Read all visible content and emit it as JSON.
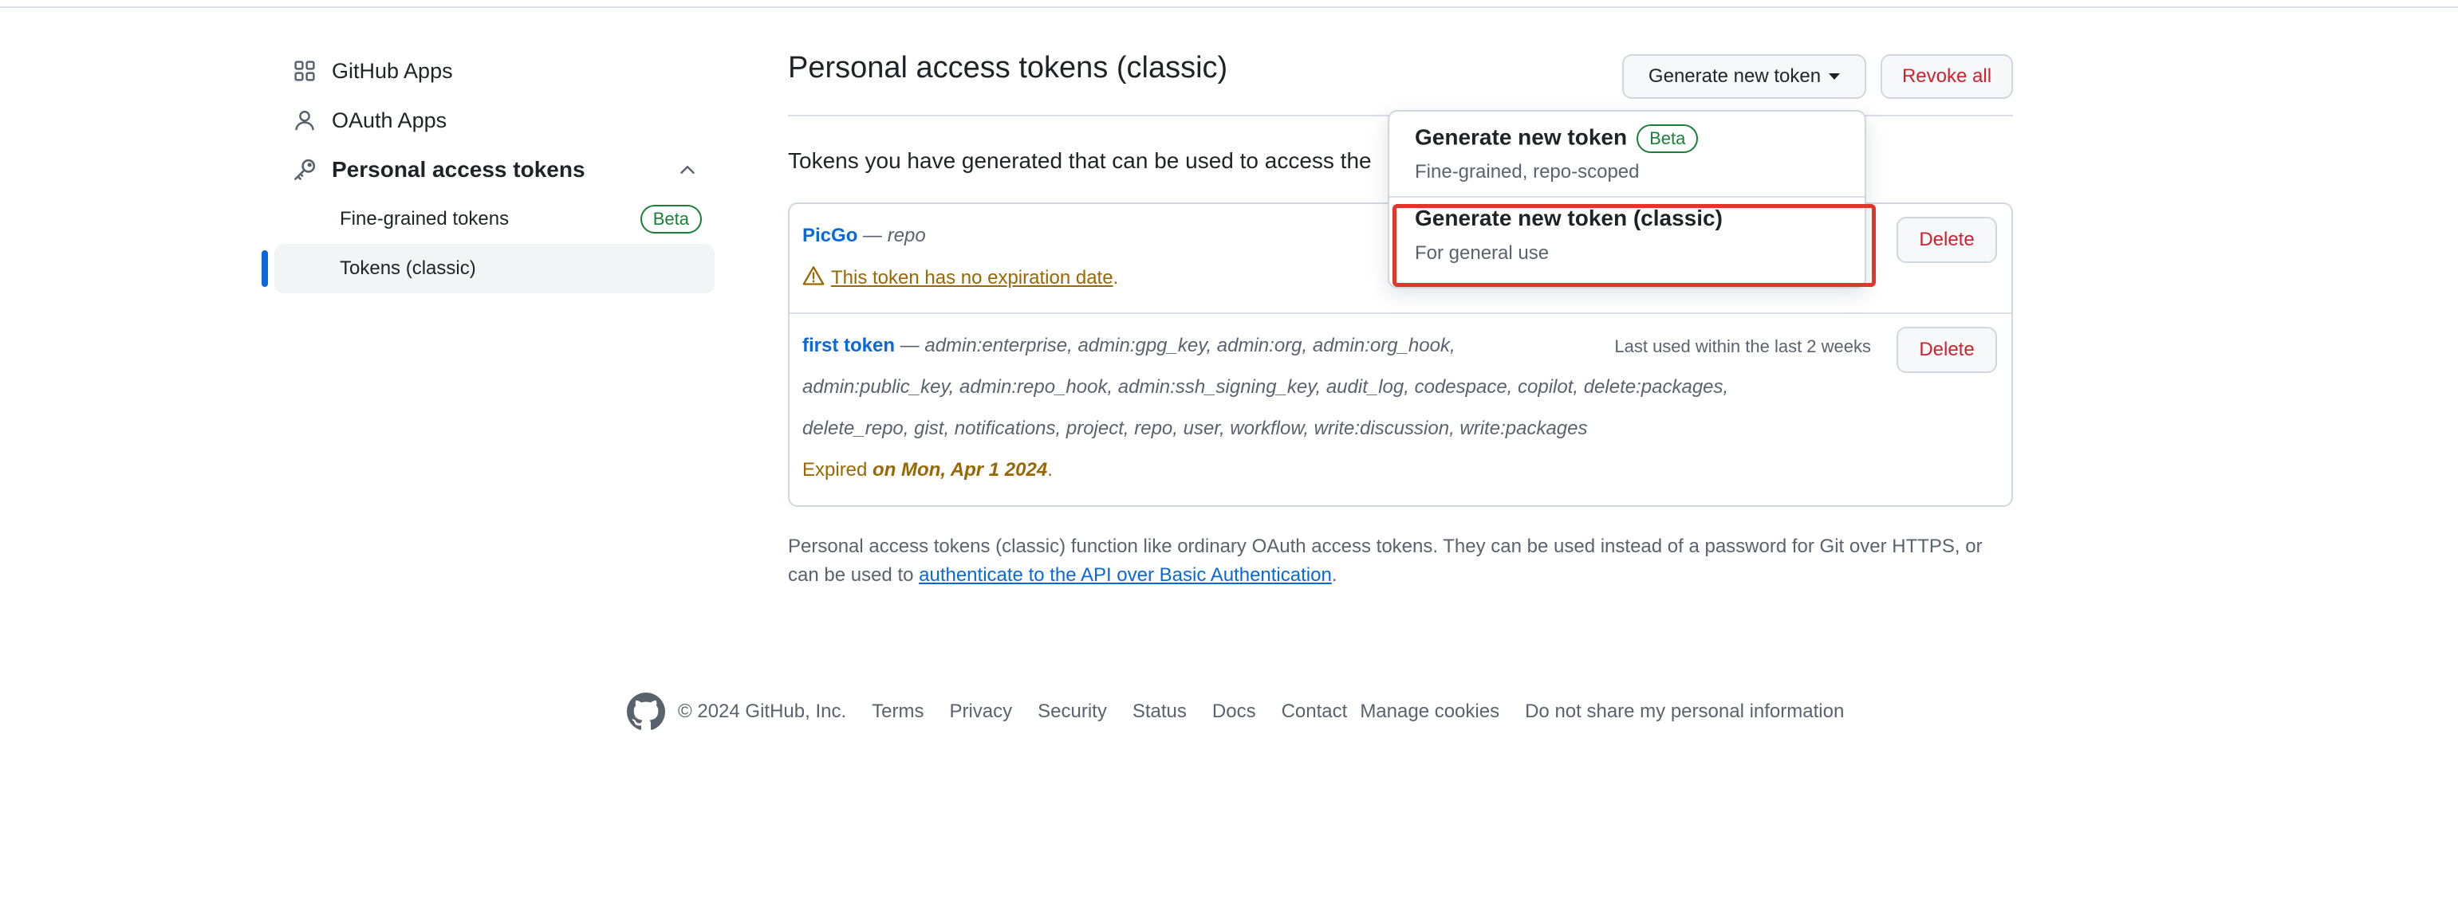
{
  "sidebar": {
    "items": [
      {
        "label": "GitHub Apps",
        "icon": "apps-icon"
      },
      {
        "label": "OAuth Apps",
        "icon": "person-icon"
      },
      {
        "label": "Personal access tokens",
        "icon": "key-icon",
        "expanded": true
      }
    ],
    "subitems": [
      {
        "label": "Fine-grained tokens",
        "badge": "Beta"
      },
      {
        "label": "Tokens (classic)",
        "active": true
      }
    ]
  },
  "main": {
    "title": "Personal access tokens (classic)",
    "generate_label": "Generate new token",
    "revoke_label": "Revoke all",
    "intro": "Tokens you have generated that can be used to access the",
    "tokens": [
      {
        "name": "PicGo",
        "dash": " — ",
        "scopes": "repo",
        "warning": "This token has no expiration date",
        "warning_end": ".",
        "delete_label": "Delete"
      },
      {
        "name": "first token",
        "dash": " — ",
        "scopes_line1": "admin:enterprise, admin:gpg_key, admin:org, admin:org_hook,",
        "scopes_line2": "admin:public_key, admin:repo_hook, admin:ssh_signing_key, audit_log, codespace, copilot, delete:packages,",
        "scopes_line3": "delete_repo, gist, notifications, project, repo, user, workflow, write:discussion, write:packages",
        "last_used": "Last used within the last 2 weeks",
        "expired_prefix": "Expired ",
        "expired_date": "on Mon, Apr 1 2024",
        "expired_end": ".",
        "delete_label": "Delete"
      }
    ],
    "footnote_text": "Personal access tokens (classic) function like ordinary OAuth access tokens. They can be used instead of a password for Git over HTTPS, or can be used to ",
    "footnote_link": "authenticate to the API over Basic Authentication",
    "footnote_end": "."
  },
  "dropdown": {
    "items": [
      {
        "title": "Generate new token",
        "badge": "Beta",
        "subtitle": "Fine-grained, repo-scoped"
      },
      {
        "title": "Generate new token (classic)",
        "subtitle": "For general use"
      }
    ],
    "highlight_color": "#e0372b"
  },
  "footer": {
    "copyright": "© 2024 GitHub, Inc.",
    "links": [
      "Terms",
      "Privacy",
      "Security",
      "Status",
      "Docs",
      "Contact",
      "Manage cookies",
      "Do not share my personal information"
    ]
  },
  "colors": {
    "link": "#0969da",
    "danger": "#cf222e",
    "success": "#1a7f37",
    "attention": "#9a6700"
  }
}
